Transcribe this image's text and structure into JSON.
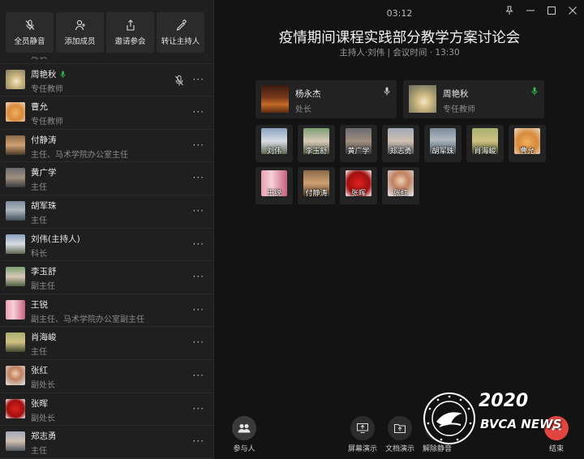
{
  "toolbar": {
    "buttons": [
      {
        "label": "全员静音",
        "icon": "mute-all-icon"
      },
      {
        "label": "添加成员",
        "icon": "add-member-icon"
      },
      {
        "label": "邀请参会",
        "icon": "share-icon"
      },
      {
        "label": "转让主持人",
        "icon": "pen-icon"
      }
    ]
  },
  "members": [
    {
      "name": "",
      "title": "处长"
    },
    {
      "name": "周艳秋",
      "title": "专任教师",
      "speaking": true,
      "muted_indicator": true
    },
    {
      "name": "曹允",
      "title": "专任教师"
    },
    {
      "name": "付静涛",
      "title": "主任、马术学院办公室主任"
    },
    {
      "name": "黄广学",
      "title": "主任"
    },
    {
      "name": "胡军珠",
      "title": "主任"
    },
    {
      "name": "刘伟(主持人)",
      "title": "科长"
    },
    {
      "name": "李玉舒",
      "title": "副主任"
    },
    {
      "name": "王锐",
      "title": "副主任、马术学院办公室副主任"
    },
    {
      "name": "肖海峻",
      "title": "主任"
    },
    {
      "name": "张红",
      "title": "副处长"
    },
    {
      "name": "张晖",
      "title": "副处长"
    },
    {
      "name": "郑志勇",
      "title": "主任"
    }
  ],
  "more_label": "···",
  "header": {
    "clock": "03:12",
    "title": "疫情期间课程实践部分教学方案讨论会",
    "subtitle": "主持人·刘伟 | 会议时间 · 13:30"
  },
  "featured": [
    {
      "name": "杨永杰",
      "title": "处长",
      "mic": "gray"
    },
    {
      "name": "周艳秋",
      "title": "专任教师",
      "mic": "green"
    }
  ],
  "tiles": [
    {
      "name": "刘伟"
    },
    {
      "name": "李玉舒"
    },
    {
      "name": "黄广学"
    },
    {
      "name": "郑志勇"
    },
    {
      "name": "胡军珠"
    },
    {
      "name": "肖海峻"
    },
    {
      "name": "曹允"
    },
    {
      "name": "王锐"
    },
    {
      "name": "付静涛"
    },
    {
      "name": "张晖"
    },
    {
      "name": "张红"
    }
  ],
  "bottom": {
    "participants": "参与人",
    "screen_share": "屏幕演示",
    "doc_share": "文档演示",
    "unmute": "解除静音",
    "end": "结束"
  },
  "watermark": {
    "year": "2020",
    "news": "BVCA NEWS",
    "seal_text": "北京农业职业学院 BVCA-1958"
  },
  "colors": {
    "accent_green": "#2db84d",
    "end_red": "#e0463f"
  }
}
